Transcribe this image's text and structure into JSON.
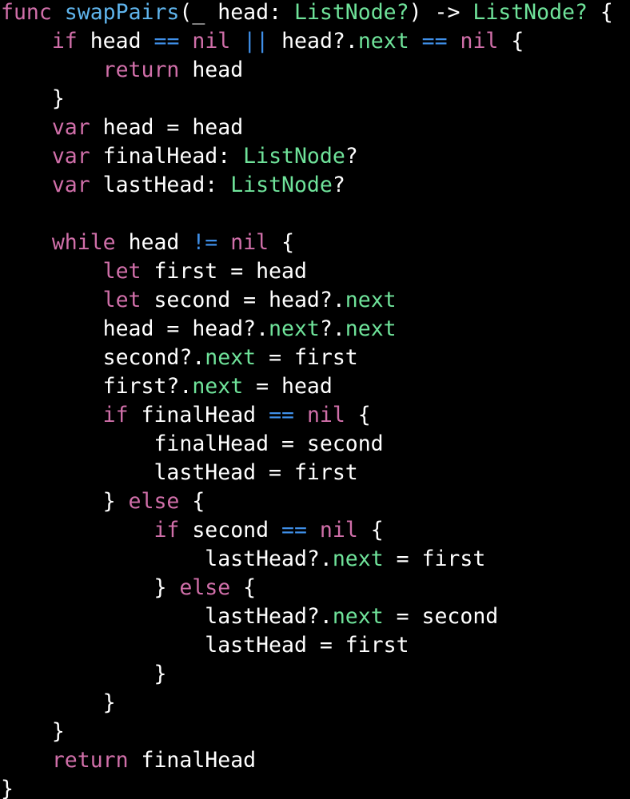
{
  "colors": {
    "background": "#000000",
    "plain": "#ffffff",
    "keyword": "#d06fa9",
    "type": "#6fe39a",
    "function": "#5fb4ec",
    "property": "#6fe39a",
    "operator": "#3f8fe8"
  },
  "code": {
    "language": "swift",
    "lines": [
      [
        {
          "t": "kw",
          "v": "func"
        },
        {
          "t": "plain",
          "v": " "
        },
        {
          "t": "func",
          "v": "swapPairs"
        },
        {
          "t": "plain",
          "v": "(_ head: "
        },
        {
          "t": "type",
          "v": "ListNode?"
        },
        {
          "t": "plain",
          "v": ") -> "
        },
        {
          "t": "type",
          "v": "ListNode?"
        },
        {
          "t": "plain",
          "v": " {"
        }
      ],
      [
        {
          "t": "plain",
          "v": "    "
        },
        {
          "t": "kw",
          "v": "if"
        },
        {
          "t": "plain",
          "v": " head "
        },
        {
          "t": "op",
          "v": "=="
        },
        {
          "t": "plain",
          "v": " "
        },
        {
          "t": "kw",
          "v": "nil"
        },
        {
          "t": "plain",
          "v": " "
        },
        {
          "t": "op",
          "v": "||"
        },
        {
          "t": "plain",
          "v": " head?."
        },
        {
          "t": "prop",
          "v": "next"
        },
        {
          "t": "plain",
          "v": " "
        },
        {
          "t": "op",
          "v": "=="
        },
        {
          "t": "plain",
          "v": " "
        },
        {
          "t": "kw",
          "v": "nil"
        },
        {
          "t": "plain",
          "v": " {"
        }
      ],
      [
        {
          "t": "plain",
          "v": "        "
        },
        {
          "t": "kw",
          "v": "return"
        },
        {
          "t": "plain",
          "v": " head"
        }
      ],
      [
        {
          "t": "plain",
          "v": "    }"
        }
      ],
      [
        {
          "t": "plain",
          "v": "    "
        },
        {
          "t": "kw",
          "v": "var"
        },
        {
          "t": "plain",
          "v": " head = head"
        }
      ],
      [
        {
          "t": "plain",
          "v": "    "
        },
        {
          "t": "kw",
          "v": "var"
        },
        {
          "t": "plain",
          "v": " finalHead: "
        },
        {
          "t": "type",
          "v": "ListNode"
        },
        {
          "t": "plain",
          "v": "?"
        }
      ],
      [
        {
          "t": "plain",
          "v": "    "
        },
        {
          "t": "kw",
          "v": "var"
        },
        {
          "t": "plain",
          "v": " lastHead: "
        },
        {
          "t": "type",
          "v": "ListNode"
        },
        {
          "t": "plain",
          "v": "?"
        }
      ],
      [],
      [
        {
          "t": "plain",
          "v": "    "
        },
        {
          "t": "kw",
          "v": "while"
        },
        {
          "t": "plain",
          "v": " head "
        },
        {
          "t": "op",
          "v": "!="
        },
        {
          "t": "plain",
          "v": " "
        },
        {
          "t": "kw",
          "v": "nil"
        },
        {
          "t": "plain",
          "v": " {"
        }
      ],
      [
        {
          "t": "plain",
          "v": "        "
        },
        {
          "t": "kw",
          "v": "let"
        },
        {
          "t": "plain",
          "v": " first = head"
        }
      ],
      [
        {
          "t": "plain",
          "v": "        "
        },
        {
          "t": "kw",
          "v": "let"
        },
        {
          "t": "plain",
          "v": " second = head?."
        },
        {
          "t": "prop",
          "v": "next"
        }
      ],
      [
        {
          "t": "plain",
          "v": "        head = head?."
        },
        {
          "t": "prop",
          "v": "next"
        },
        {
          "t": "plain",
          "v": "?."
        },
        {
          "t": "prop",
          "v": "next"
        }
      ],
      [
        {
          "t": "plain",
          "v": "        second?."
        },
        {
          "t": "prop",
          "v": "next"
        },
        {
          "t": "plain",
          "v": " = first"
        }
      ],
      [
        {
          "t": "plain",
          "v": "        first?."
        },
        {
          "t": "prop",
          "v": "next"
        },
        {
          "t": "plain",
          "v": " = head"
        }
      ],
      [
        {
          "t": "plain",
          "v": "        "
        },
        {
          "t": "kw",
          "v": "if"
        },
        {
          "t": "plain",
          "v": " finalHead "
        },
        {
          "t": "op",
          "v": "=="
        },
        {
          "t": "plain",
          "v": " "
        },
        {
          "t": "kw",
          "v": "nil"
        },
        {
          "t": "plain",
          "v": " {"
        }
      ],
      [
        {
          "t": "plain",
          "v": "            finalHead = second"
        }
      ],
      [
        {
          "t": "plain",
          "v": "            lastHead = first"
        }
      ],
      [
        {
          "t": "plain",
          "v": "        } "
        },
        {
          "t": "kw",
          "v": "else"
        },
        {
          "t": "plain",
          "v": " {"
        }
      ],
      [
        {
          "t": "plain",
          "v": "            "
        },
        {
          "t": "kw",
          "v": "if"
        },
        {
          "t": "plain",
          "v": " second "
        },
        {
          "t": "op",
          "v": "=="
        },
        {
          "t": "plain",
          "v": " "
        },
        {
          "t": "kw",
          "v": "nil"
        },
        {
          "t": "plain",
          "v": " {"
        }
      ],
      [
        {
          "t": "plain",
          "v": "                lastHead?."
        },
        {
          "t": "prop",
          "v": "next"
        },
        {
          "t": "plain",
          "v": " = first"
        }
      ],
      [
        {
          "t": "plain",
          "v": "            } "
        },
        {
          "t": "kw",
          "v": "else"
        },
        {
          "t": "plain",
          "v": " {"
        }
      ],
      [
        {
          "t": "plain",
          "v": "                lastHead?."
        },
        {
          "t": "prop",
          "v": "next"
        },
        {
          "t": "plain",
          "v": " = second"
        }
      ],
      [
        {
          "t": "plain",
          "v": "                lastHead = first"
        }
      ],
      [
        {
          "t": "plain",
          "v": "            }"
        }
      ],
      [
        {
          "t": "plain",
          "v": "        }"
        }
      ],
      [
        {
          "t": "plain",
          "v": "    }"
        }
      ],
      [
        {
          "t": "plain",
          "v": "    "
        },
        {
          "t": "kw",
          "v": "return"
        },
        {
          "t": "plain",
          "v": " finalHead"
        }
      ],
      [
        {
          "t": "plain",
          "v": "}"
        }
      ]
    ]
  }
}
